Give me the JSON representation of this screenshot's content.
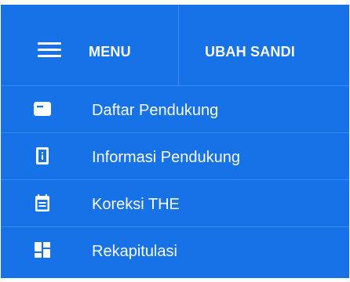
{
  "header": {
    "menu_label": "MENU",
    "change_password_label": "UBAH SANDI",
    "menu_icon": "hamburger-icon"
  },
  "menu": {
    "items": [
      {
        "label": "Daftar Pendukung",
        "icon": "card-list-icon"
      },
      {
        "label": "Informasi Pendukung",
        "icon": "info-device-icon"
      },
      {
        "label": "Koreksi THE",
        "icon": "calendar-edit-icon"
      },
      {
        "label": "Rekapitulasi",
        "icon": "dashboard-grid-icon"
      }
    ]
  },
  "colors": {
    "background": "#1672e6",
    "divider": "#3b8aee",
    "text": "#ffffff"
  }
}
